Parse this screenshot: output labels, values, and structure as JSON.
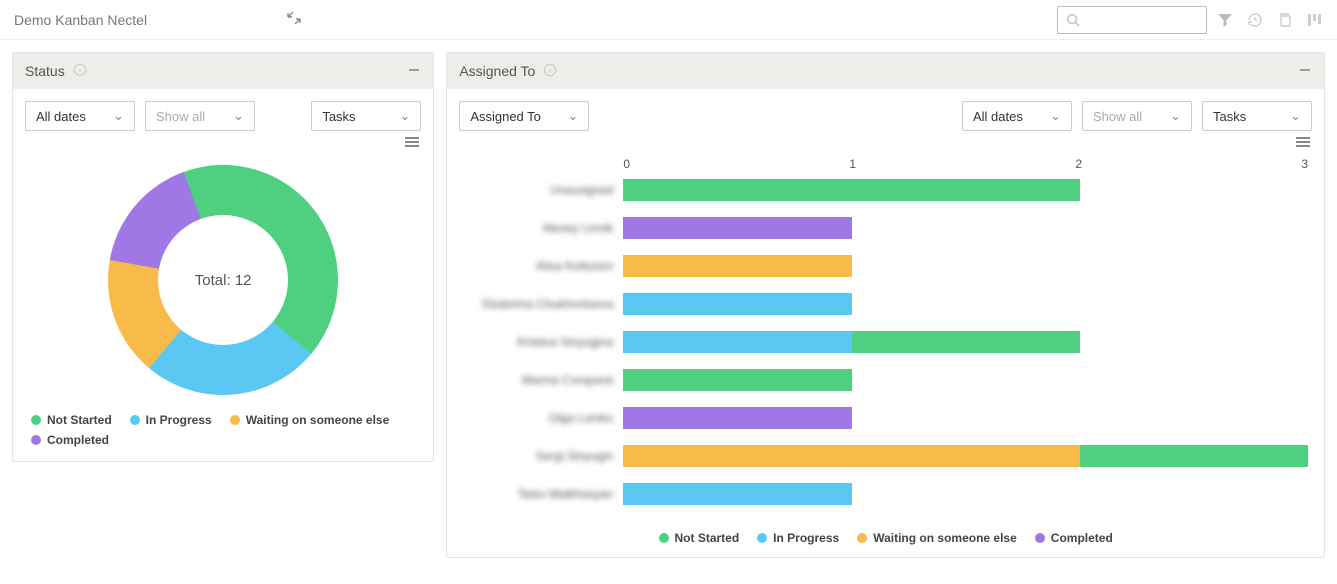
{
  "header": {
    "title": "Demo Kanban Nectel",
    "search_placeholder": ""
  },
  "colors": {
    "not_started": "#4fcf80",
    "in_progress": "#5ac8f2",
    "waiting": "#f8bb4a",
    "completed": "#a078e6"
  },
  "status_panel": {
    "title": "Status",
    "filter_dates": "All dates",
    "filter_showall": "Show all",
    "filter_tasks": "Tasks",
    "total_label": "Total: 12",
    "legend": {
      "not_started": "Not Started",
      "in_progress": "In Progress",
      "waiting": "Waiting on someone else",
      "completed": "Completed"
    }
  },
  "assigned_panel": {
    "title": "Assigned To",
    "filter_assigned": "Assigned To",
    "filter_dates": "All dates",
    "filter_showall": "Show all",
    "filter_tasks": "Tasks",
    "legend": {
      "not_started": "Not Started",
      "in_progress": "In Progress",
      "waiting": "Waiting on someone else",
      "completed": "Completed"
    }
  },
  "chart_data": [
    {
      "type": "pie",
      "title": "Status",
      "total": 12,
      "series": [
        {
          "name": "Not Started",
          "value": 5,
          "color": "#4fcf80"
        },
        {
          "name": "In Progress",
          "value": 3,
          "color": "#5ac8f2"
        },
        {
          "name": "Waiting on someone else",
          "value": 2,
          "color": "#f8bb4a"
        },
        {
          "name": "Completed",
          "value": 2,
          "color": "#a078e6"
        }
      ]
    },
    {
      "type": "bar",
      "orientation": "horizontal",
      "stacked": true,
      "title": "Assigned To",
      "xlabel": "",
      "ylabel": "",
      "xlim": [
        0,
        3
      ],
      "xticks": [
        0,
        1,
        2,
        3
      ],
      "categories": [
        "Unassigned",
        "Alexey Linnik",
        "Alisa Kettunen",
        "Ekaterina Chukhontseva",
        "Kristina Sinyugina",
        "Marina Conquest",
        "Olga Lomko",
        "Sergi Sinyugin",
        "Tatev Malkhasyan"
      ],
      "series": [
        {
          "name": "Not Started",
          "color": "#4fcf80",
          "values": [
            2,
            0,
            0,
            0,
            1,
            1,
            0,
            1,
            0
          ]
        },
        {
          "name": "In Progress",
          "color": "#5ac8f2",
          "values": [
            0,
            0,
            0,
            1,
            1,
            0,
            0,
            0,
            1
          ]
        },
        {
          "name": "Waiting on someone else",
          "color": "#f8bb4a",
          "values": [
            0,
            0,
            1,
            0,
            0,
            0,
            0,
            2,
            0
          ]
        },
        {
          "name": "Completed",
          "color": "#a078e6",
          "values": [
            0,
            1,
            0,
            0,
            0,
            0,
            1,
            0,
            0
          ]
        }
      ]
    }
  ]
}
